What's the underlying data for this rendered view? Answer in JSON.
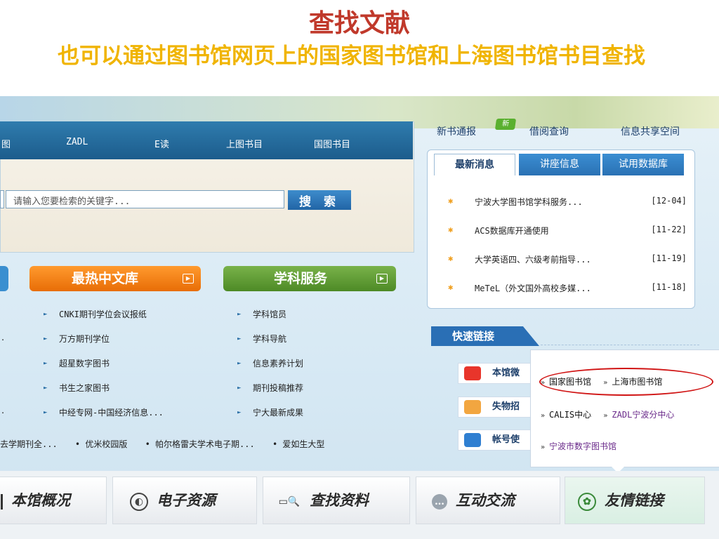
{
  "slide": {
    "title": "查找文献",
    "subtitle": "也可以通过图书馆网页上的国家图书馆和上海图书馆书目查找"
  },
  "nav": {
    "items": [
      "图",
      "ZADL",
      "E读",
      "上图书目",
      "国图书目"
    ]
  },
  "search": {
    "placeholder": "请输入您要检索的关键字...",
    "button": "搜 索"
  },
  "categories": {
    "hot_chinese": "最热中文库",
    "subject_service": "学科服务"
  },
  "hot_chinese_list": [
    "CNKI期刊学位会议报纸",
    "万方期刊学位",
    "超星数字图书",
    "书生之家图书",
    "中经专网-中国经济信息..."
  ],
  "subject_list": [
    "学科馆员",
    "学科导航",
    "信息素养计划",
    "期刊投稿推荐",
    "宁大最新成果"
  ],
  "bottom_strip": [
    "去学期刊全...",
    "• 优米校园版",
    "• 帕尔格雷夫学术电子期...",
    "• 爱如生大型"
  ],
  "top_links": {
    "new_books": "新书通报",
    "new_badge": "新",
    "borrow": "借阅查询",
    "info_commons": "信息共享空间"
  },
  "tabs": [
    "最新消息",
    "讲座信息",
    "试用数据库"
  ],
  "news": [
    {
      "title": "宁波大学图书馆学科服务...",
      "date": "[12-04]"
    },
    {
      "title": "ACS数据库开通使用",
      "date": "[11-22]"
    },
    {
      "title": "大学英语四、六级考前指导...",
      "date": "[11-19]"
    },
    {
      "title": "MeTeL（外文国外高校多媒...",
      "date": "[11-18]"
    }
  ],
  "quick_links": {
    "header": "快速链接",
    "items": [
      "本馆微",
      "失物招",
      "帐号使"
    ]
  },
  "popup_links": {
    "national_library": "国家图书馆",
    "shanghai_library": "上海市图书馆",
    "calis": "CALIS中心",
    "zadl_ningbo": "ZADL宁波分中心",
    "ningbo_digital": "宁波市数字图书馆"
  },
  "bottom_tabs": [
    "本馆概况",
    "电子资源",
    "查找资料",
    "互动交流",
    "友情链接"
  ],
  "colors": {
    "title_red": "#c0392b",
    "subtitle_yellow": "#f0b400",
    "nav_blue": "#1c5c8c",
    "orange": "#e86d06",
    "green": "#4d8a26",
    "highlight_red": "#d01414"
  }
}
